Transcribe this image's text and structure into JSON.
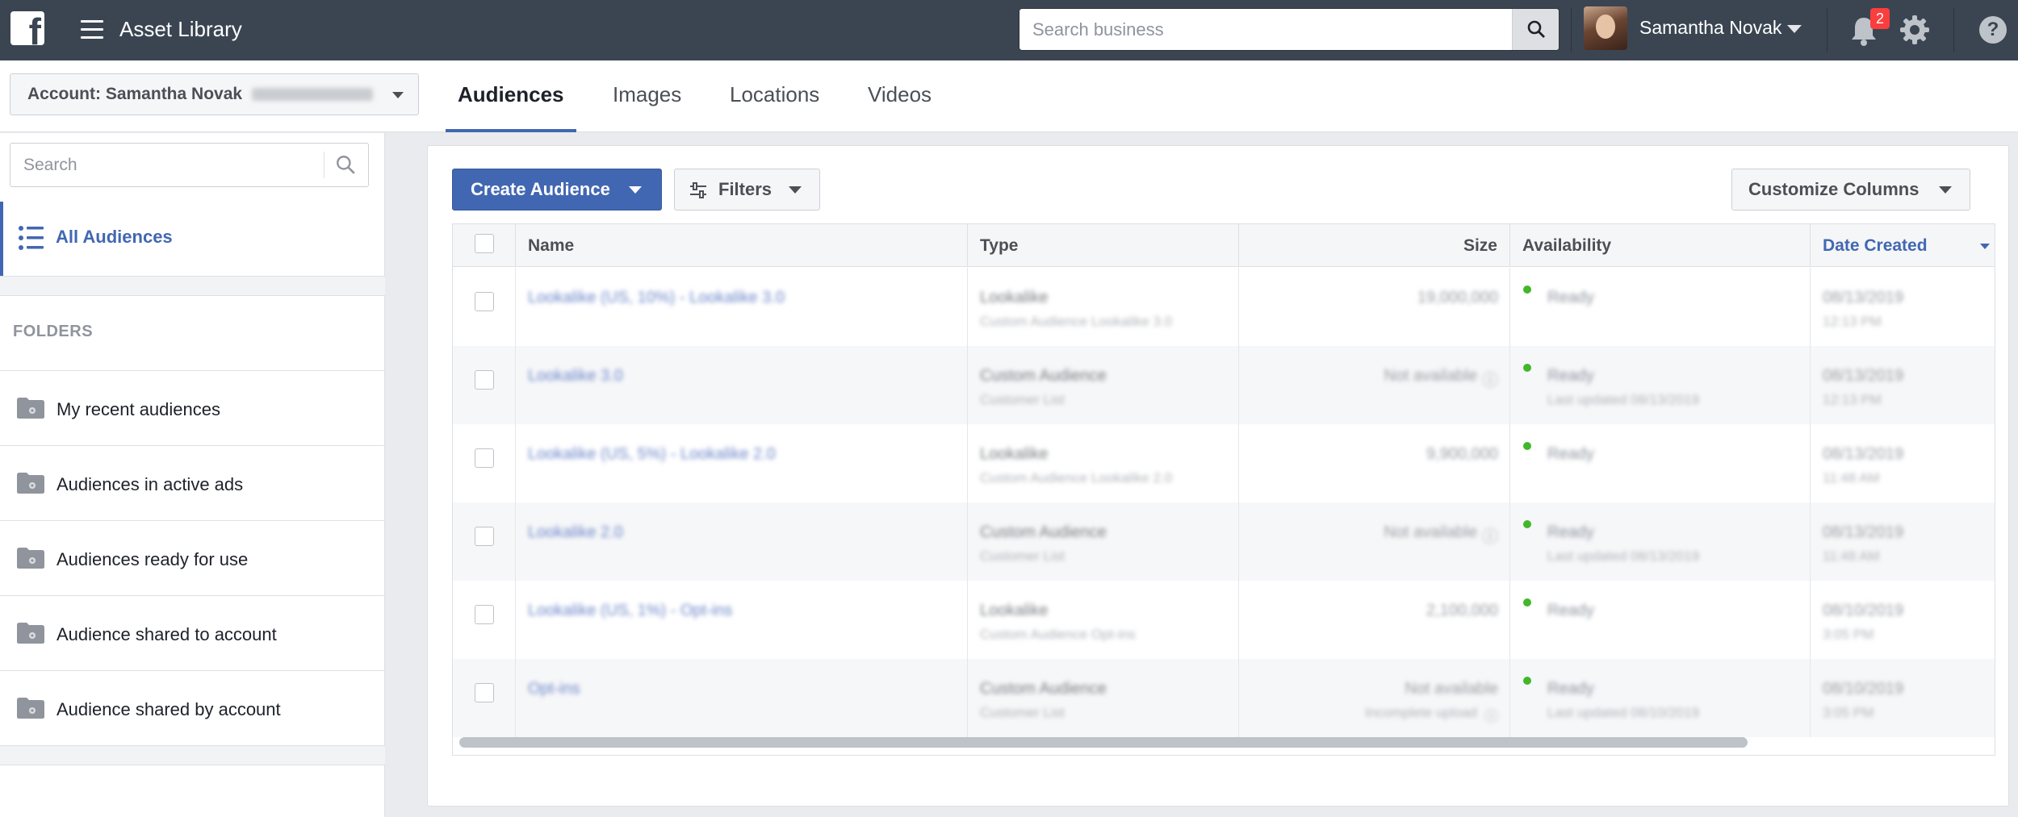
{
  "topbar": {
    "app_title": "Asset Library",
    "search_placeholder": "Search business",
    "user_name": "Samantha Novak",
    "notifications_count": "2",
    "help_label": "?"
  },
  "subbar": {
    "account_label": "Account: Samantha Novak",
    "tabs": [
      {
        "label": "Audiences",
        "active": true
      },
      {
        "label": "Images",
        "active": false
      },
      {
        "label": "Locations",
        "active": false
      },
      {
        "label": "Videos",
        "active": false
      }
    ]
  },
  "sidebar": {
    "search_placeholder": "Search",
    "all_audiences_label": "All Audiences",
    "folders_heading": "FOLDERS",
    "folders": [
      "My recent audiences",
      "Audiences in active ads",
      "Audiences ready for use",
      "Audience shared to account",
      "Audience shared by account"
    ]
  },
  "toolbar": {
    "create_label": "Create Audience",
    "filters_label": "Filters",
    "customize_label": "Customize Columns"
  },
  "table": {
    "columns": [
      "Name",
      "Type",
      "Size",
      "Availability",
      "Date Created"
    ],
    "sorted_column": "Date Created",
    "rows": [
      {
        "name": "Lookalike (US, 10%) - Lookalike 3.0",
        "type": "Lookalike",
        "subtype": "Custom Audience Lookalike 3.0",
        "size": "19,000,000",
        "size_note": "",
        "availability": "Ready",
        "availability_note": "",
        "date": "08/13/2019",
        "time": "12:13 PM"
      },
      {
        "name": "Lookalike 3.0",
        "type": "Custom Audience",
        "subtype": "Customer List",
        "size": "Not available",
        "size_note": "",
        "availability": "Ready",
        "availability_note": "Last updated 08/13/2019",
        "date": "08/13/2019",
        "time": "12:13 PM"
      },
      {
        "name": "Lookalike (US, 5%) - Lookalike 2.0",
        "type": "Lookalike",
        "subtype": "Custom Audience Lookalike 2.0",
        "size": "9,900,000",
        "size_note": "",
        "availability": "Ready",
        "availability_note": "",
        "date": "08/13/2019",
        "time": "11:48 AM"
      },
      {
        "name": "Lookalike 2.0",
        "type": "Custom Audience",
        "subtype": "Customer List",
        "size": "Not available",
        "size_note": "",
        "availability": "Ready",
        "availability_note": "Last updated 08/13/2019",
        "date": "08/13/2019",
        "time": "11:48 AM"
      },
      {
        "name": "Lookalike (US, 1%) - Opt-ins",
        "type": "Lookalike",
        "subtype": "Custom Audience Opt-ins",
        "size": "2,100,000",
        "size_note": "",
        "availability": "Ready",
        "availability_note": "",
        "date": "08/10/2019",
        "time": "3:05 PM"
      },
      {
        "name": "Opt-ins",
        "type": "Custom Audience",
        "subtype": "Customer List",
        "size": "Not available",
        "size_note": "Incomplete upload",
        "availability": "Ready",
        "availability_note": "Last updated 08/10/2019",
        "date": "08/10/2019",
        "time": "3:05 PM"
      }
    ]
  },
  "colors": {
    "topbar_bg": "#3b4552",
    "brand_blue": "#4267b2",
    "ready_green": "#42b72a",
    "badge_red": "#fa3e3e"
  }
}
